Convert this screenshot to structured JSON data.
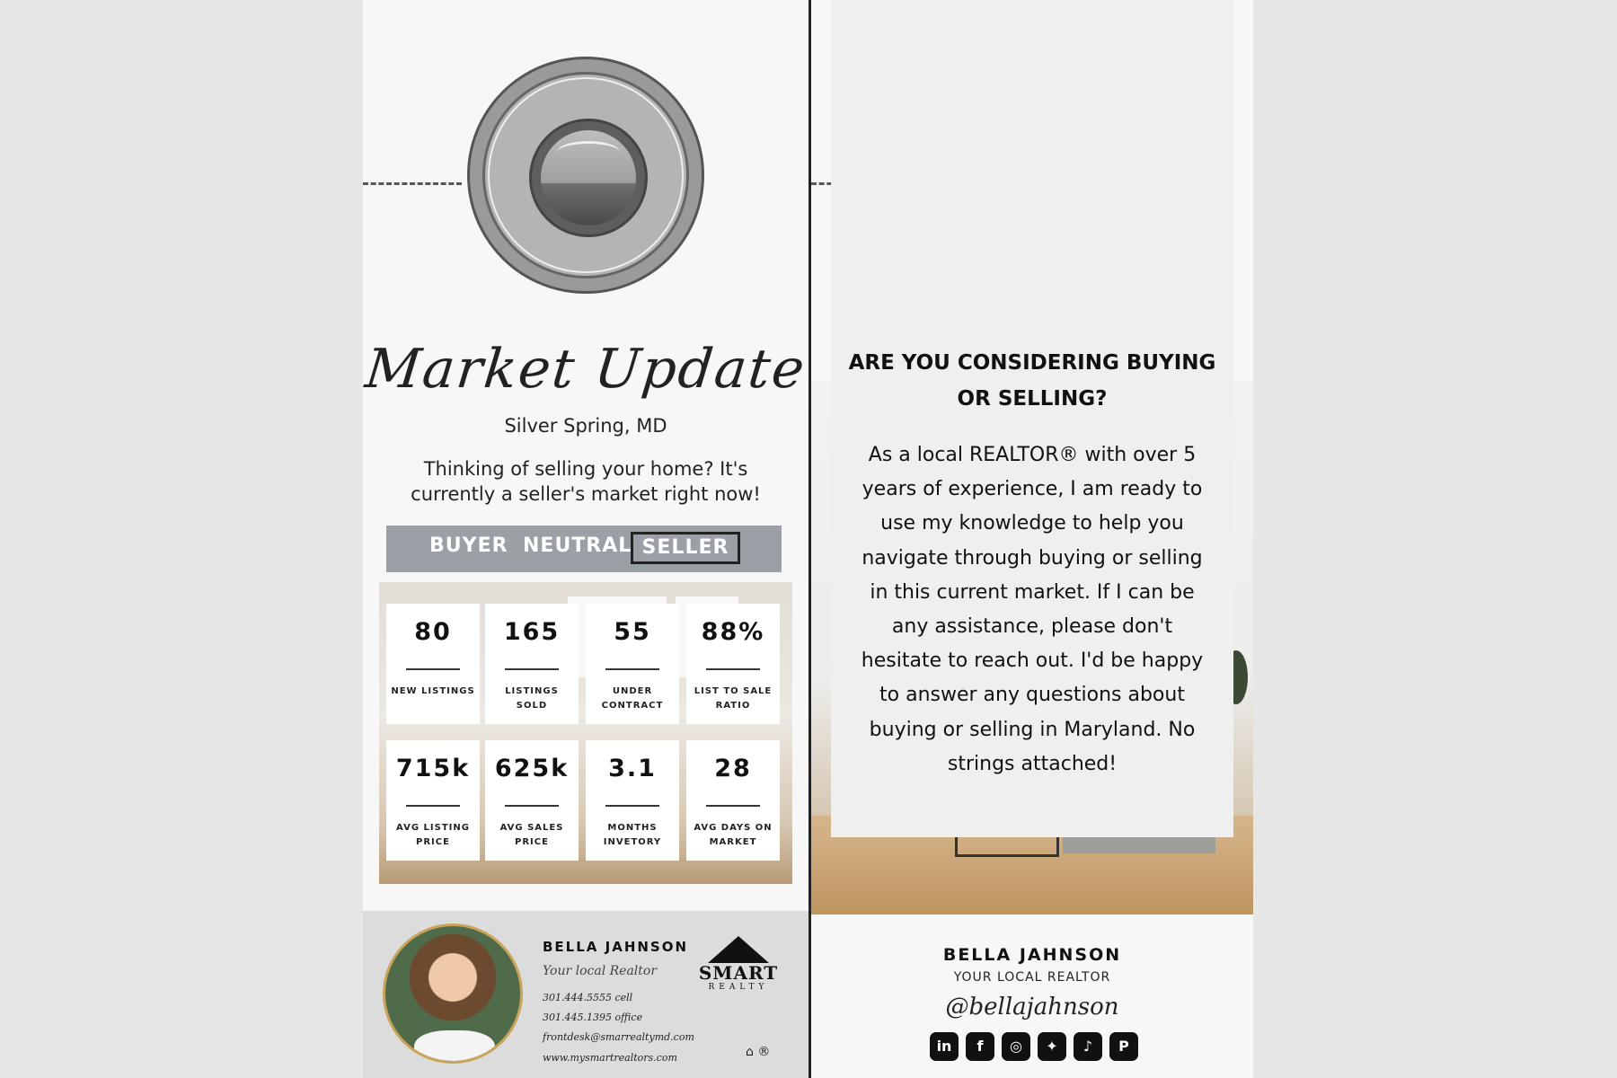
{
  "left": {
    "title": "Market Update",
    "location": "Silver Spring, MD",
    "pitch": "Thinking of selling your home? It's currently a seller's market right now!",
    "scale": {
      "buyer": "BUYER",
      "neutral": "NEUTRAL",
      "seller": "SELLER",
      "selected": "SELLER"
    },
    "stats": [
      {
        "value": "80",
        "label": "NEW LISTINGS"
      },
      {
        "value": "165",
        "label": "LISTINGS SOLD"
      },
      {
        "value": "55",
        "label": "UNDER CONTRACT"
      },
      {
        "value": "88%",
        "label": "LIST TO SALE RATIO"
      },
      {
        "value": "715k",
        "label": "AVG LISTING PRICE"
      },
      {
        "value": "625k",
        "label": "AVG SALES PRICE"
      },
      {
        "value": "3.1",
        "label": "MONTHS INVETORY"
      },
      {
        "value": "28",
        "label": "AVG DAYS ON MARKET"
      }
    ],
    "agent": {
      "name": "BELLA JAHNSON",
      "tagline": "Your local Realtor",
      "cell": "301.444.5555 cell",
      "office": "301.445.1395 office",
      "email": "frontdesk@smarrealtymd.com",
      "website": "www.mysmartrealtors.com"
    },
    "brand": {
      "word": "SMART",
      "sub": "REALTY"
    }
  },
  "right": {
    "heading": "ARE YOU CONSIDERING BUYING OR SELLING?",
    "body": "As a local REALTOR® with over 5 years of experience, I am ready to use my knowledge to help you navigate through buying or selling in this current market. If I can be any assistance, please don't hesitate to reach out. I'd be happy to answer any questions about buying or selling in Maryland. No strings attached!",
    "agent_name": "BELLA JAHNSON",
    "agent_tag": "YOUR LOCAL REALTOR",
    "handle": "@bellajahnson",
    "socials": [
      "linkedin-icon",
      "facebook-icon",
      "instagram-icon",
      "twitter-icon",
      "tiktok-icon",
      "pinterest-icon"
    ]
  },
  "colors": {
    "scale_bar": "#9aa0a5",
    "accent_gold": "#c9a35a",
    "text": "#111111"
  }
}
